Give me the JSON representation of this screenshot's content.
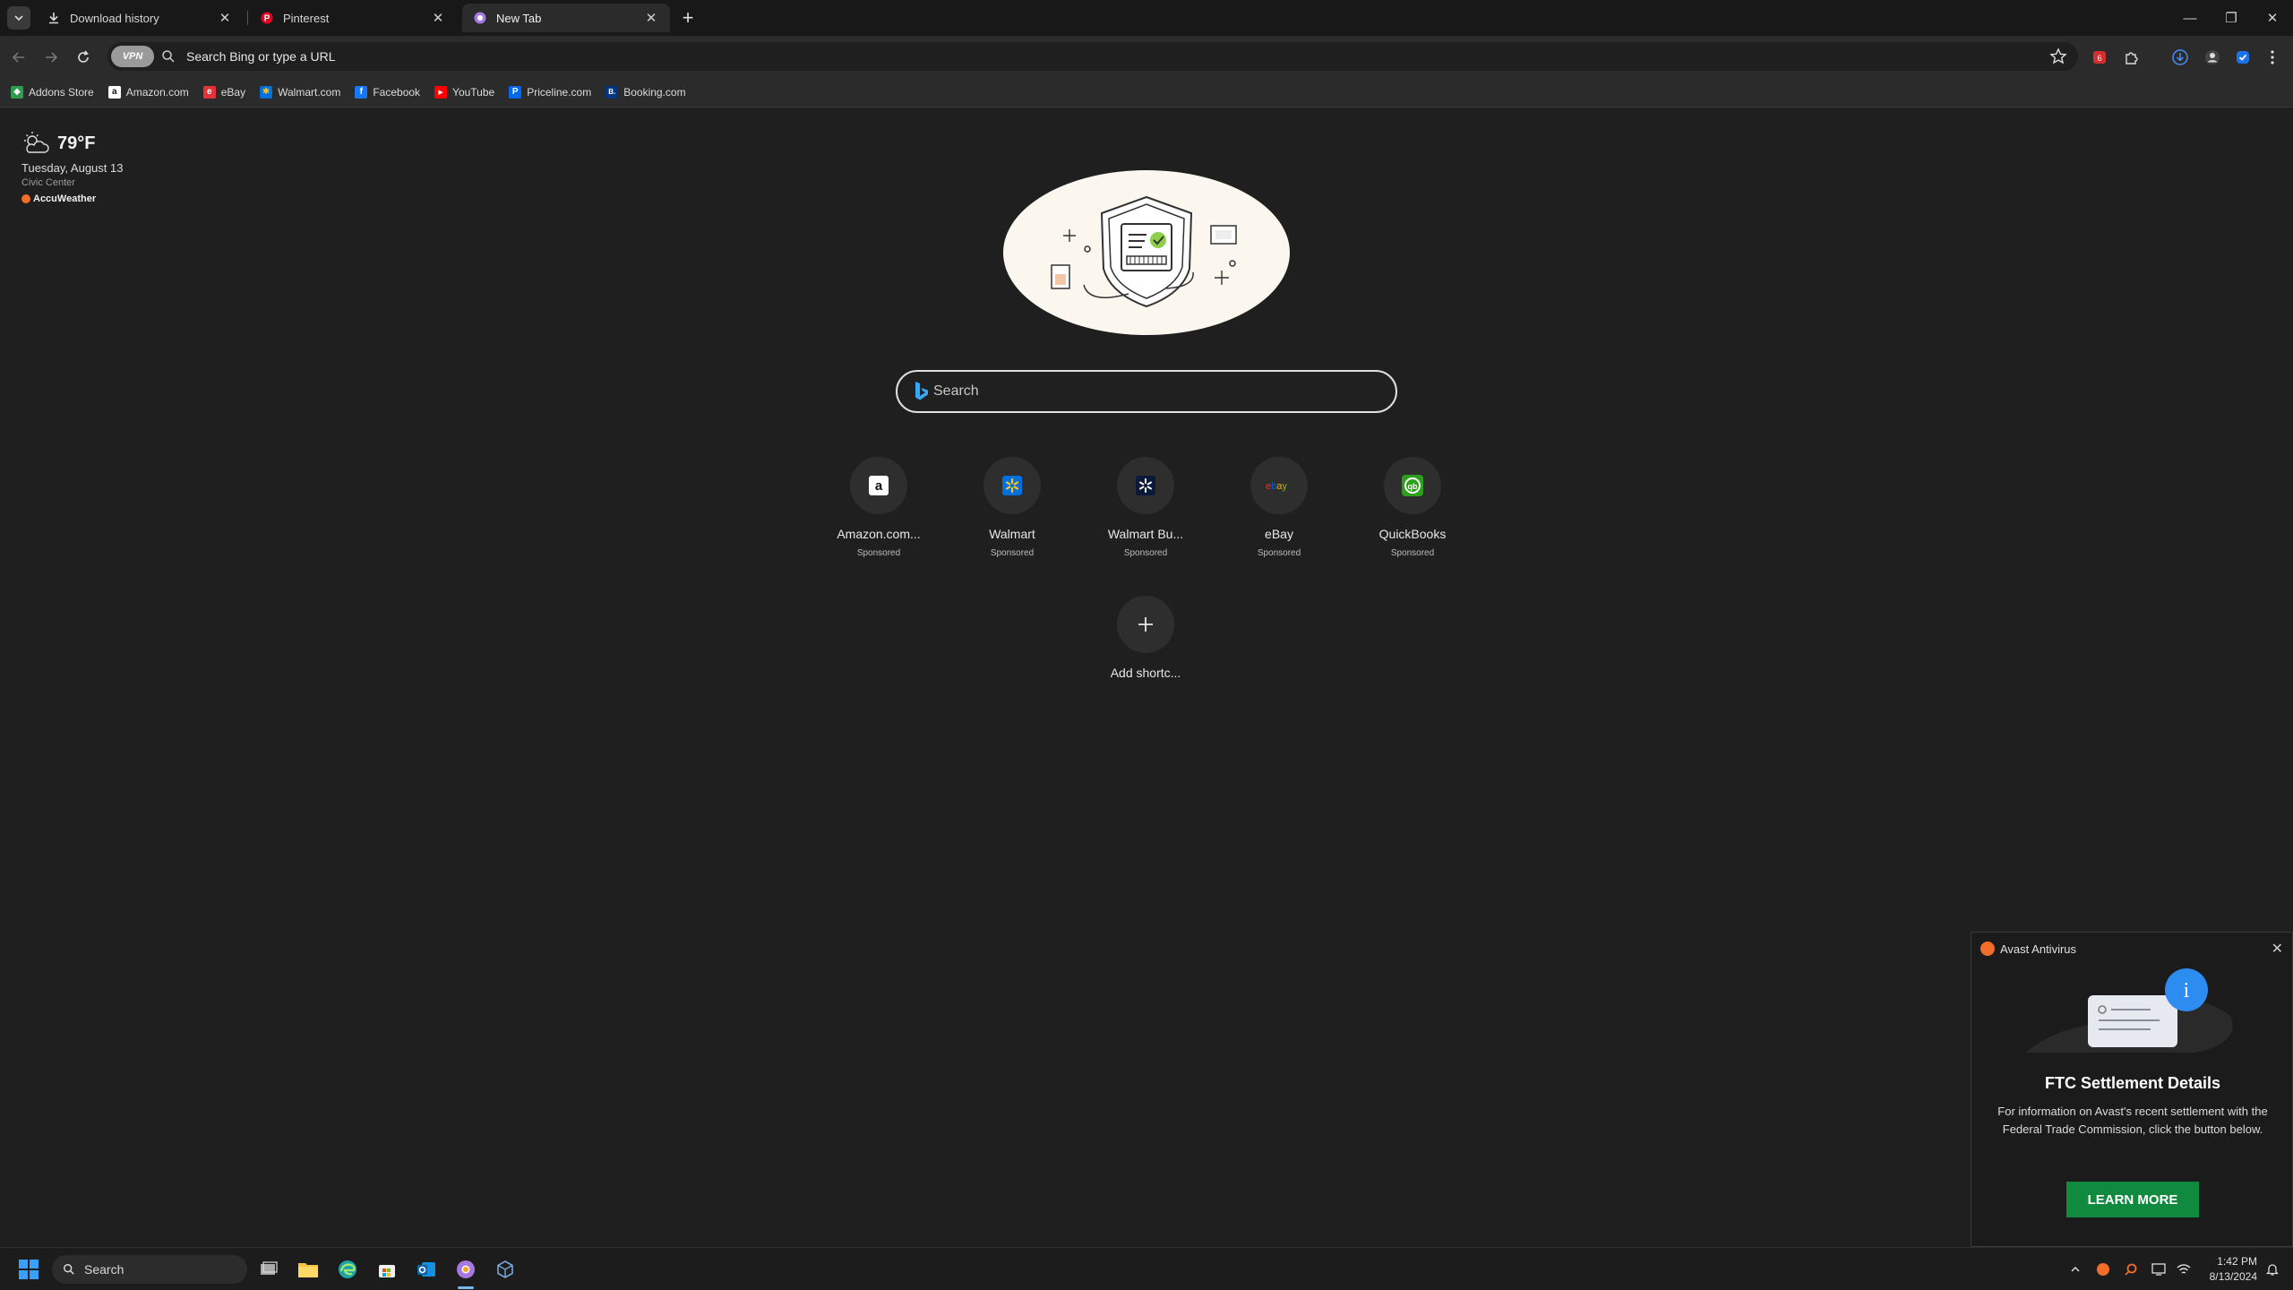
{
  "browser": {
    "tabs": [
      {
        "title": "Download history",
        "icon": "download-icon",
        "active": false
      },
      {
        "title": "Pinterest",
        "icon": "pinterest-icon",
        "active": false
      },
      {
        "title": "New Tab",
        "icon": "browser-icon",
        "active": true
      }
    ],
    "new_tab_symbol": "+",
    "close_symbol": "✕"
  },
  "toolbar": {
    "vpn_label": "VPN",
    "omnibox_placeholder": "Search Bing or type a URL"
  },
  "bookmarks": [
    {
      "label": "Addons Store",
      "icon": "addons-icon",
      "color": "#2e9b4f",
      "glyph": "◆"
    },
    {
      "label": "Amazon.com",
      "icon": "amazon-icon",
      "color": "#ffffff",
      "glyph": "a"
    },
    {
      "label": "eBay",
      "icon": "ebay-icon",
      "color": "#e53238",
      "glyph": "e"
    },
    {
      "label": "Walmart.com",
      "icon": "walmart-icon",
      "color": "#0071dc",
      "glyph": "✱"
    },
    {
      "label": "Facebook",
      "icon": "facebook-icon",
      "color": "#1877f2",
      "glyph": "f"
    },
    {
      "label": "YouTube",
      "icon": "youtube-icon",
      "color": "#ff0000",
      "glyph": "▶"
    },
    {
      "label": "Priceline.com",
      "icon": "priceline-icon",
      "color": "#0068ef",
      "glyph": "P"
    },
    {
      "label": "Booking.com",
      "icon": "booking-icon",
      "color": "#003580",
      "glyph": "B."
    }
  ],
  "weather": {
    "temp": "79°F",
    "date": "Tuesday, August 13",
    "location": "Civic Center",
    "source": "AccuWeather"
  },
  "search": {
    "placeholder": "Search"
  },
  "shortcuts": [
    {
      "label": "Amazon.com...",
      "sub": "Sponsored",
      "icon": "amazon-icon"
    },
    {
      "label": "Walmart",
      "sub": "Sponsored",
      "icon": "walmart-icon"
    },
    {
      "label": "Walmart Bu...",
      "sub": "Sponsored",
      "icon": "walmart-business-icon"
    },
    {
      "label": "eBay",
      "sub": "Sponsored",
      "icon": "ebay-icon"
    },
    {
      "label": "QuickBooks",
      "sub": "Sponsored",
      "icon": "quickbooks-icon"
    }
  ],
  "add_shortcut": {
    "label": "Add shortc..."
  },
  "avast_popup": {
    "app": "Avast Antivirus",
    "title": "FTC Settlement Details",
    "body": "For information on Avast's recent settlement with the Federal Trade Commission, click the button below.",
    "button": "LEARN MORE",
    "button_color": "#0f8a3e"
  },
  "taskbar": {
    "search_label": "Search",
    "time": "1:42 PM",
    "date": "8/13/2024"
  }
}
